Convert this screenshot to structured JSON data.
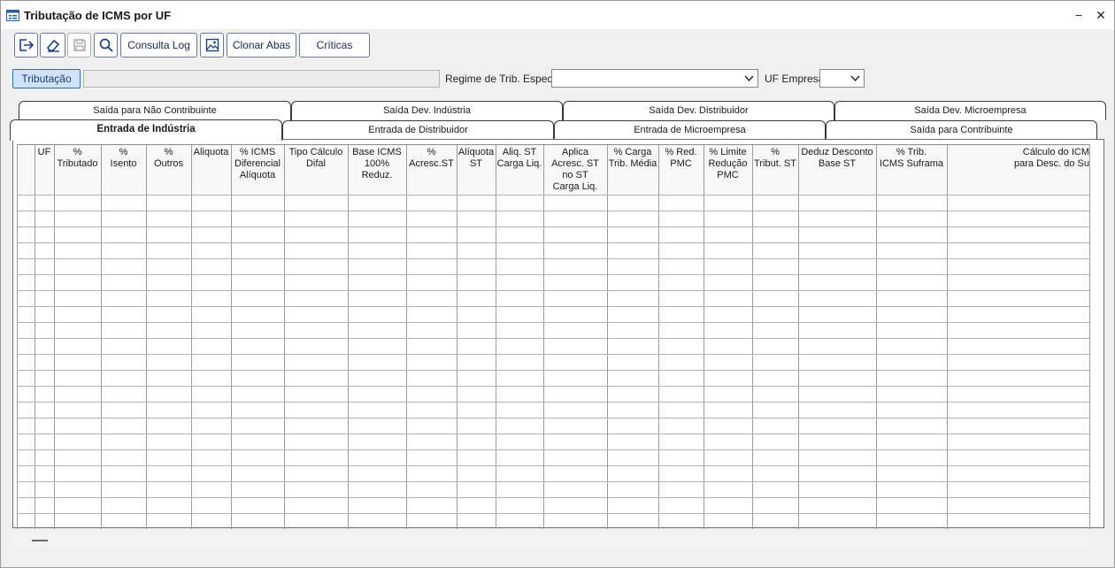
{
  "window": {
    "title": "Tributação de ICMS por UF",
    "icon": "form-window-icon"
  },
  "window_controls": {
    "minimize": "−",
    "close": "✕"
  },
  "toolbar": {
    "exit_icon": "exit-icon",
    "clear_icon": "eraser-icon",
    "save_icon": "save-icon",
    "search_icon": "search-icon",
    "consulta_log": "Consulta Log",
    "image_icon": "image-icon",
    "clonar_abas": "Clonar Abas",
    "criticas": "Críticas"
  },
  "filters": {
    "tributacao_button": "Tributação",
    "tributacao_value": "",
    "regime_label": "Regime de Trib. Especial",
    "regime_value": "",
    "uf_label": "UF Empresa",
    "uf_value": ""
  },
  "tabs_row1": [
    {
      "label": "Saída para Não Contribuinte"
    },
    {
      "label": "Saída Dev. Indústria"
    },
    {
      "label": "Saída Dev. Distribuidor"
    },
    {
      "label": "Saída Dev. Microempresa"
    }
  ],
  "tabs_row2": [
    {
      "label": "Entrada de Indústria",
      "active": true
    },
    {
      "label": "Entrada de Distribuidor"
    },
    {
      "label": "Entrada de Microempresa"
    },
    {
      "label": "Saída para Contribuinte"
    }
  ],
  "grid": {
    "columns": [
      "UF",
      "%\nTributado",
      "%\nIsento",
      "%\nOutros",
      "Aliquota",
      "% ICMS\nDiferencial\nAlíquota",
      "Tipo Cálculo\nDifal",
      "Base ICMS\n100% Reduz.",
      "%\nAcresc.ST",
      "Alíquota\nST",
      "Aliq. ST\nCarga Liq.",
      "Aplica\nAcresc. ST\nno ST\nCarga Liq.",
      "% Carga\nTrib. Média",
      "% Red.\nPMC",
      "% Limite\nRedução\nPMC",
      "%\nTribut. ST",
      "Deduz Desconto\nBase ST",
      "% Trib.\nICMS Suframa",
      "Cálculo do ICM\npara Desc. do Su"
    ],
    "rows": []
  }
}
